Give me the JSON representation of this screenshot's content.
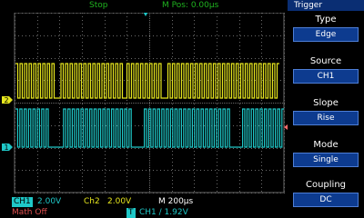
{
  "header": {
    "run_state": "Stop",
    "mpos": "M Pos: 0.00µs"
  },
  "panel": {
    "title": "Trigger",
    "items": [
      {
        "label": "Type",
        "value": "Edge"
      },
      {
        "label": "Source",
        "value": "CH1"
      },
      {
        "label": "Slope",
        "value": "Rise"
      },
      {
        "label": "Mode",
        "value": "Single"
      },
      {
        "label": "Coupling",
        "value": "DC"
      }
    ]
  },
  "footer": {
    "ch1_label": "CH1",
    "ch1_scale": "2.00V",
    "ch2_label": "Ch2",
    "ch2_scale": "2.00V",
    "timebase": "M 200µs",
    "math": "Math Off",
    "trigger_marker": "T",
    "trigger_info": "CH1 ∕ 1.92V"
  },
  "channel_markers": {
    "ch2": "2",
    "ch1": "1"
  },
  "colors": {
    "ch1": "#1fc8c8",
    "ch2": "#e6e61e",
    "grid": "#6a6a6a",
    "panel": "#0d3b8f"
  }
}
